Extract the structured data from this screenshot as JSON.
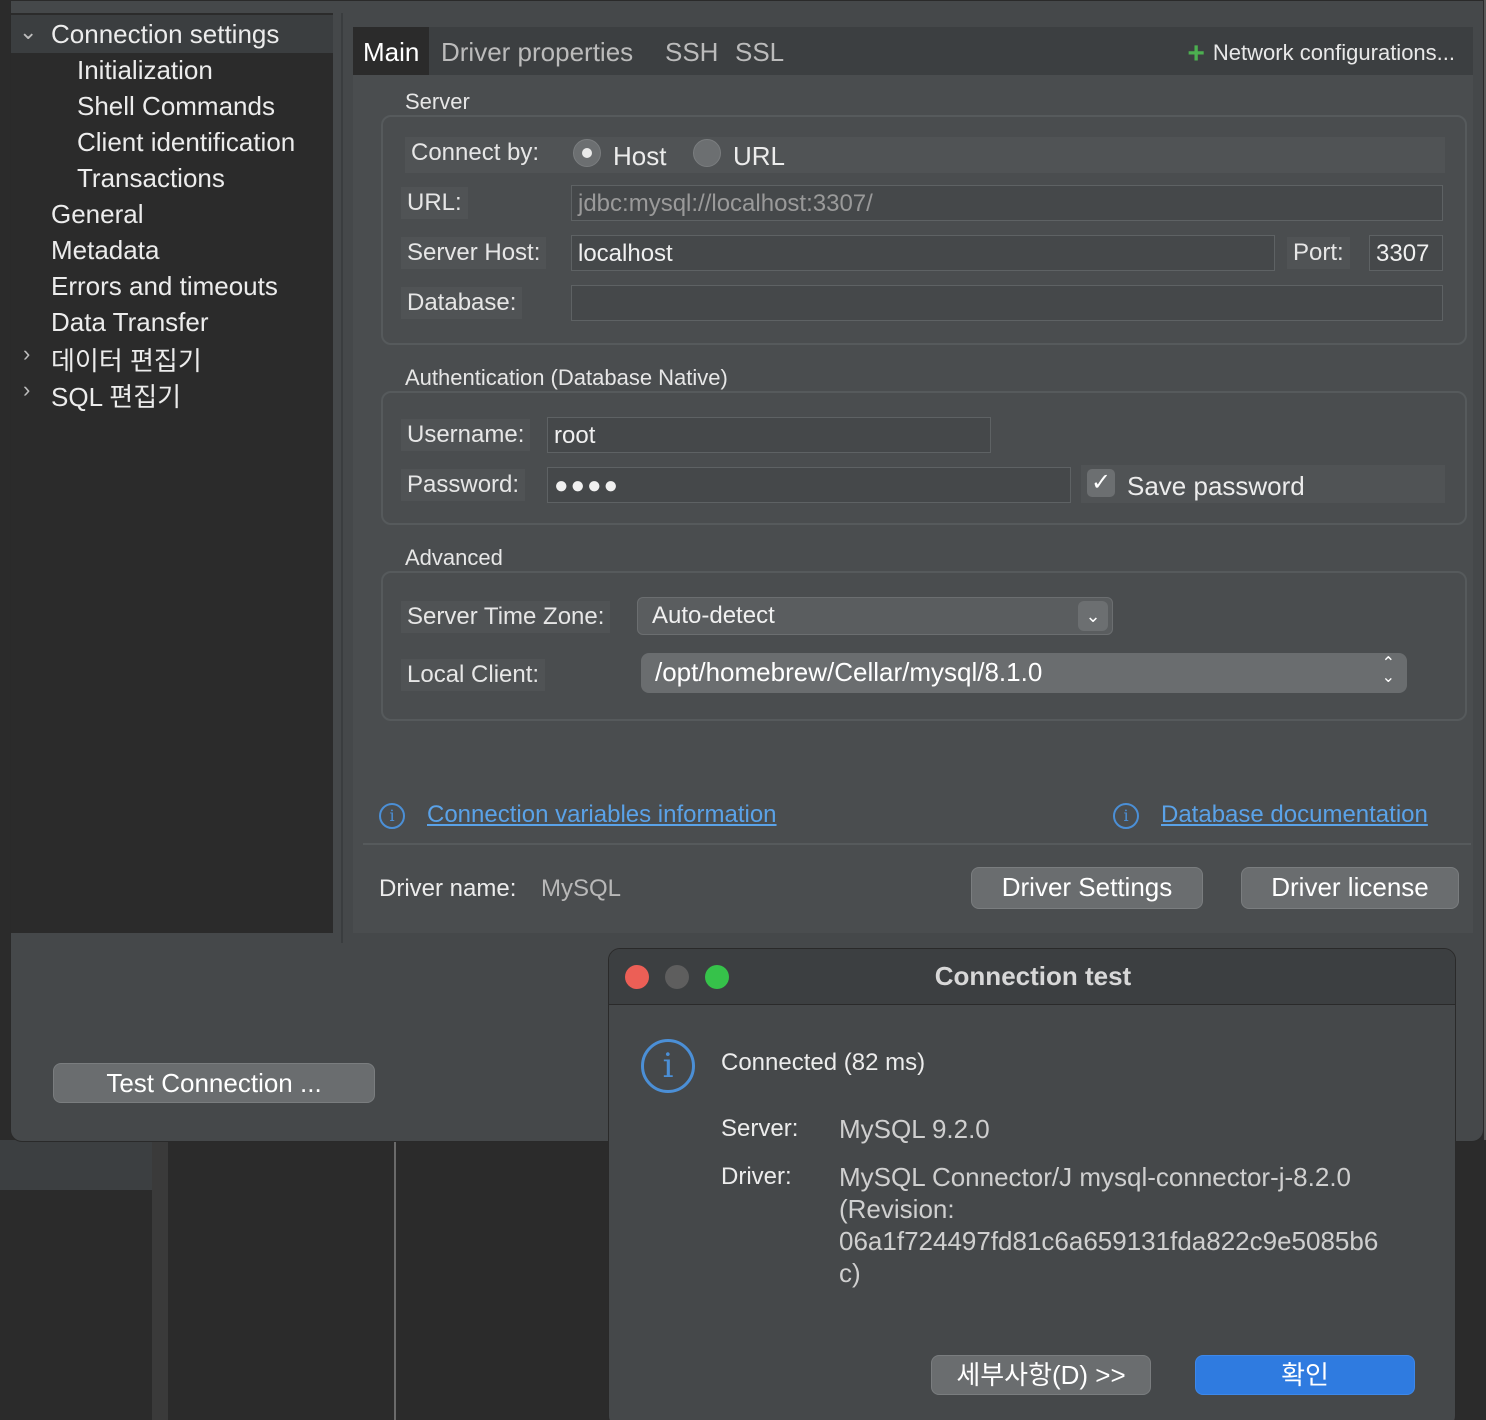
{
  "sidebar": {
    "items": [
      {
        "label": "Connection settings",
        "chevron": "down"
      },
      {
        "label": "Initialization"
      },
      {
        "label": "Shell Commands"
      },
      {
        "label": "Client identification"
      },
      {
        "label": "Transactions"
      },
      {
        "label": "General"
      },
      {
        "label": "Metadata"
      },
      {
        "label": "Errors and timeouts"
      },
      {
        "label": "Data Transfer"
      },
      {
        "label": "데이터 편집기",
        "chevron": "right"
      },
      {
        "label": "SQL 편집기",
        "chevron": "right"
      }
    ]
  },
  "tabs": [
    {
      "label": "Main"
    },
    {
      "label": "Driver properties"
    },
    {
      "label": "SSH"
    },
    {
      "label": "SSL"
    }
  ],
  "network_config": {
    "icon": "plus-icon",
    "label": "Network configurations..."
  },
  "server": {
    "title": "Server",
    "connect_by_label": "Connect by:",
    "options": [
      {
        "label": "Host",
        "selected": true
      },
      {
        "label": "URL",
        "selected": false
      }
    ],
    "url_label": "URL:",
    "url_value": "jdbc:mysql://localhost:3307/",
    "host_label": "Server Host:",
    "host_value": "localhost",
    "port_label": "Port:",
    "port_value": "3307",
    "database_label": "Database:",
    "database_value": ""
  },
  "auth": {
    "title": "Authentication (Database Native)",
    "username_label": "Username:",
    "username_value": "root",
    "password_label": "Password:",
    "password_value": "●●●●",
    "save_password_label": "Save password",
    "save_password_checked": true
  },
  "advanced": {
    "title": "Advanced",
    "timezone_label": "Server Time Zone:",
    "timezone_value": "Auto-detect",
    "local_client_label": "Local Client:",
    "local_client_value": "/opt/homebrew/Cellar/mysql/8.1.0"
  },
  "links": {
    "conn_vars": "Connection variables information",
    "db_docs": "Database documentation"
  },
  "driver": {
    "name_label": "Driver name:",
    "name_value": "MySQL",
    "settings_button": "Driver Settings",
    "license_button": "Driver license"
  },
  "test_button": "Test Connection ...",
  "connection_test": {
    "title": "Connection test",
    "status": "Connected (82 ms)",
    "server_label": "Server:",
    "server_value": "MySQL 9.2.0",
    "driver_label": "Driver:",
    "driver_line1": "MySQL Connector/J mysql-connector-j-8.2.0",
    "driver_line2": "(Revision:",
    "driver_line3": "06a1f724497fd81c6a659131fda822c9e5085b6",
    "driver_line4": "c)",
    "details_button": "세부사항(D) >>",
    "ok_button": "확인"
  },
  "colors": {
    "accent": "#2f7be0",
    "link": "#5aa2e8",
    "close": "#ec5f56",
    "minimize": "#5e5e5e",
    "zoom": "#36c24a"
  }
}
